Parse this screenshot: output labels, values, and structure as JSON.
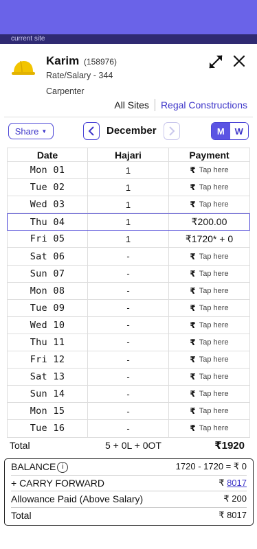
{
  "status_bar": {
    "site_label": "current site"
  },
  "worker": {
    "name": "Karim",
    "id": "(158976)",
    "rate_line": "Rate/Salary - 344",
    "role": "Carpenter"
  },
  "sites": {
    "all_label": "All Sites",
    "current_label": "Regal Constructions"
  },
  "toolbar": {
    "share_label": "Share",
    "month": "December",
    "m_label": "M",
    "w_label": "W"
  },
  "table": {
    "headers": [
      "Date",
      "Hajari",
      "Payment"
    ],
    "rows": [
      {
        "date": "Mon 01",
        "hajari": "1",
        "payment": "Tap here",
        "type": "tap"
      },
      {
        "date": "Tue 02",
        "hajari": "1",
        "payment": "Tap here",
        "type": "tap"
      },
      {
        "date": "Wed 03",
        "hajari": "1",
        "payment": "Tap here",
        "type": "tap"
      },
      {
        "date": "Thu 04",
        "hajari": "1",
        "payment": "₹200.00",
        "type": "amount",
        "highlight": true
      },
      {
        "date": "Fri 05",
        "hajari": "1",
        "payment": "₹1720* + 0",
        "type": "amount"
      },
      {
        "date": "Sat 06",
        "hajari": "-",
        "payment": "Tap here",
        "type": "tap"
      },
      {
        "date": "Sun 07",
        "hajari": "-",
        "payment": "Tap here",
        "type": "tap"
      },
      {
        "date": "Mon 08",
        "hajari": "-",
        "payment": "Tap here",
        "type": "tap"
      },
      {
        "date": "Tue 09",
        "hajari": "-",
        "payment": "Tap here",
        "type": "tap"
      },
      {
        "date": "Wed 10",
        "hajari": "-",
        "payment": "Tap here",
        "type": "tap"
      },
      {
        "date": "Thu 11",
        "hajari": "-",
        "payment": "Tap here",
        "type": "tap"
      },
      {
        "date": "Fri 12",
        "hajari": "-",
        "payment": "Tap here",
        "type": "tap"
      },
      {
        "date": "Sat 13",
        "hajari": "-",
        "payment": "Tap here",
        "type": "tap"
      },
      {
        "date": "Sun 14",
        "hajari": "-",
        "payment": "Tap here",
        "type": "tap"
      },
      {
        "date": "Mon 15",
        "hajari": "-",
        "payment": "Tap here",
        "type": "tap"
      },
      {
        "date": "Tue 16",
        "hajari": "-",
        "payment": "Tap here",
        "type": "tap"
      }
    ],
    "rupee_symbol": "₹"
  },
  "totals": {
    "label": "Total",
    "hajari": "5 + 0L + 0OT",
    "payment": "₹1920"
  },
  "balance": {
    "balance_label": "BALANCE",
    "balance_value": "1720 - 1720 = ₹ 0",
    "carry_label": "+ CARRY FORWARD",
    "carry_prefix": "₹ ",
    "carry_value": "8017",
    "allowance_label": "Allowance Paid (Above Salary)",
    "allowance_value": "₹ 200",
    "total_label": "Total",
    "total_value": "₹ 8017"
  },
  "colors": {
    "accent": "#5b54e3",
    "header_bar": "#6a63e8",
    "link": "#3d35c9"
  }
}
